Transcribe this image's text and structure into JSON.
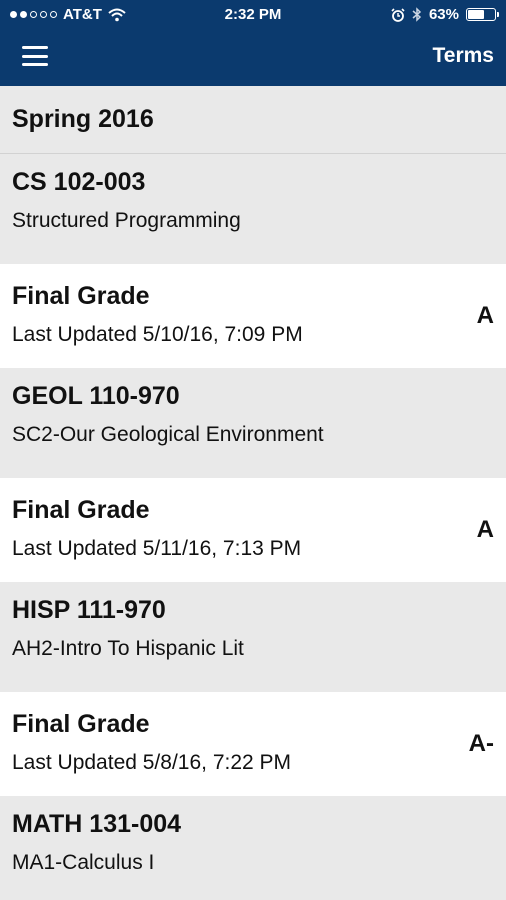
{
  "status_bar": {
    "carrier": "AT&T",
    "time": "2:32 PM",
    "battery": "63%",
    "battery_level": 0.63,
    "icons": [
      "signal-dots-icon",
      "wifi-icon",
      "alarm-icon",
      "bluetooth-icon",
      "battery-icon"
    ]
  },
  "nav": {
    "menu_icon": "hamburger-menu-icon",
    "terms_label": "Terms"
  },
  "term": {
    "title": "Spring 2016"
  },
  "courses": [
    {
      "code": "CS 102-003",
      "name": "Structured Programming",
      "grade_label": "Final Grade",
      "updated": "Last Updated 5/10/16, 7:09 PM",
      "grade": "A"
    },
    {
      "code": "GEOL 110-970",
      "name": "SC2-Our Geological Environment",
      "grade_label": "Final Grade",
      "updated": "Last Updated 5/11/16, 7:13 PM",
      "grade": "A"
    },
    {
      "code": "HISP 111-970",
      "name": "AH2-Intro To Hispanic Lit",
      "grade_label": "Final Grade",
      "updated": "Last Updated 5/8/16, 7:22 PM",
      "grade": "A-"
    },
    {
      "code": "MATH 131-004",
      "name": "MA1-Calculus I"
    }
  ],
  "colors": {
    "nav_background": "#0b3a6e",
    "course_background": "#e9e9e9",
    "grade_background": "#ffffff"
  }
}
